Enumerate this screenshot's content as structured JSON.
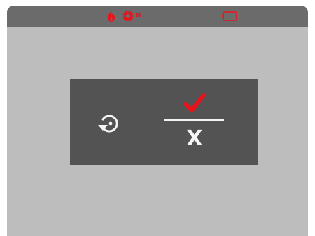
{
  "status_bar": {
    "icons": [
      "flash-icon",
      "exposure-compensation-icon",
      "battery-icon"
    ],
    "ev_badge": "B"
  },
  "dialog": {
    "icons": [
      "rotate-icon",
      "checkmark-icon"
    ],
    "cancel_label": "X"
  },
  "colors": {
    "screen_background": "#bdbdbd",
    "status_bar": "#6b6b6b",
    "dialog_background": "#535353",
    "accent_red": "#e8141c",
    "icon_white": "#f5f5f5"
  }
}
